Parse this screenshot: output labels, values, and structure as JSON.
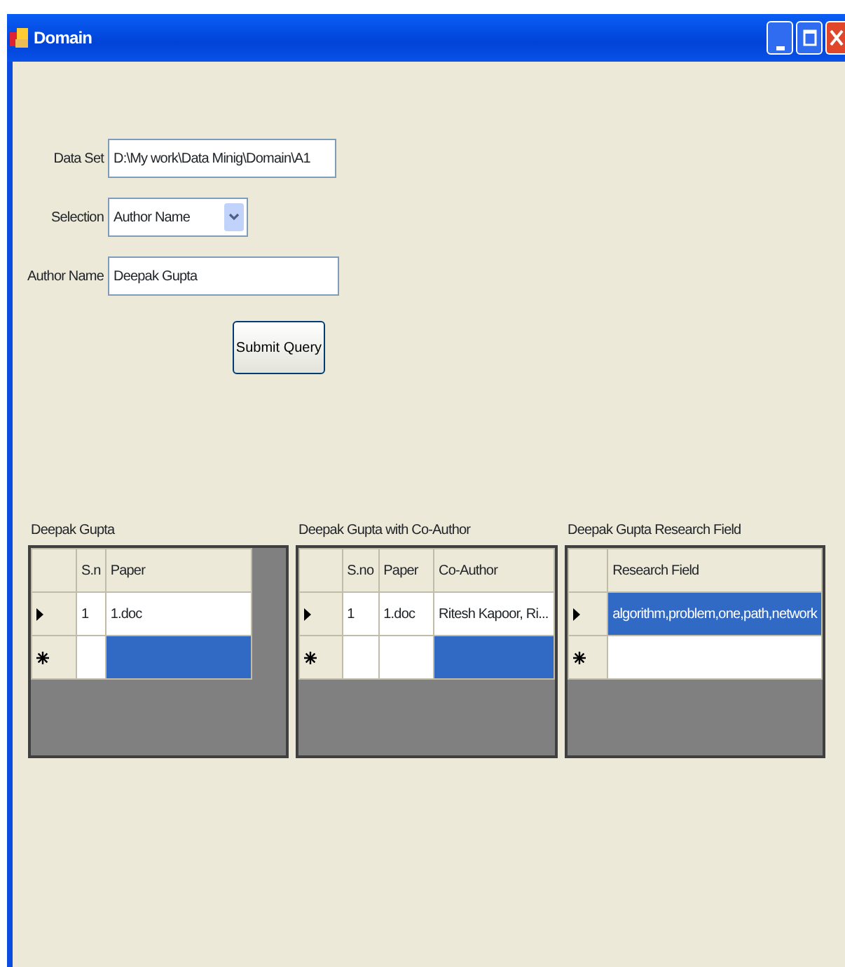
{
  "window": {
    "title": "Domain"
  },
  "form": {
    "fields": [
      {
        "kind": "text",
        "label": "Data Set",
        "value": "D:\\My work\\Data Minig\\Domain\\A1"
      },
      {
        "kind": "select",
        "label": "Selection",
        "value": "Author Name"
      },
      {
        "kind": "text",
        "label": "Author Name",
        "value": "Deepak Gupta"
      }
    ],
    "submit": "Submit Query"
  },
  "grids": [
    {
      "title": "Deepak Gupta",
      "columns": [
        "S.n",
        "Paper"
      ],
      "rows": [
        {
          "kind": "current",
          "cells": [
            {
              "text": "1",
              "selected": false
            },
            {
              "text": "1.doc",
              "selected": false
            }
          ]
        },
        {
          "kind": "new",
          "cells": [
            {
              "selected": false
            },
            {
              "selected": true
            }
          ]
        }
      ]
    },
    {
      "title": "Deepak Gupta with Co-Author",
      "columns": [
        "S.no",
        "Paper",
        "Co-Author"
      ],
      "rows": [
        {
          "kind": "current",
          "cells": [
            {
              "text": "1",
              "selected": false
            },
            {
              "text": "1.doc",
              "selected": false
            },
            {
              "text": "Ritesh Kapoor,  Ri...",
              "selected": false
            }
          ]
        },
        {
          "kind": "new",
          "cells": [
            {
              "selected": false
            },
            {
              "selected": false
            },
            {
              "selected": true
            }
          ]
        }
      ]
    },
    {
      "title": "Deepak Gupta Research Field",
      "columns": [
        "Research Field"
      ],
      "rows": [
        {
          "kind": "current",
          "cells": [
            {
              "text": "algorithm,problem,one,path,network",
              "selected": true
            }
          ]
        },
        {
          "kind": "new",
          "cells": [
            {
              "selected": false
            }
          ]
        }
      ]
    }
  ]
}
